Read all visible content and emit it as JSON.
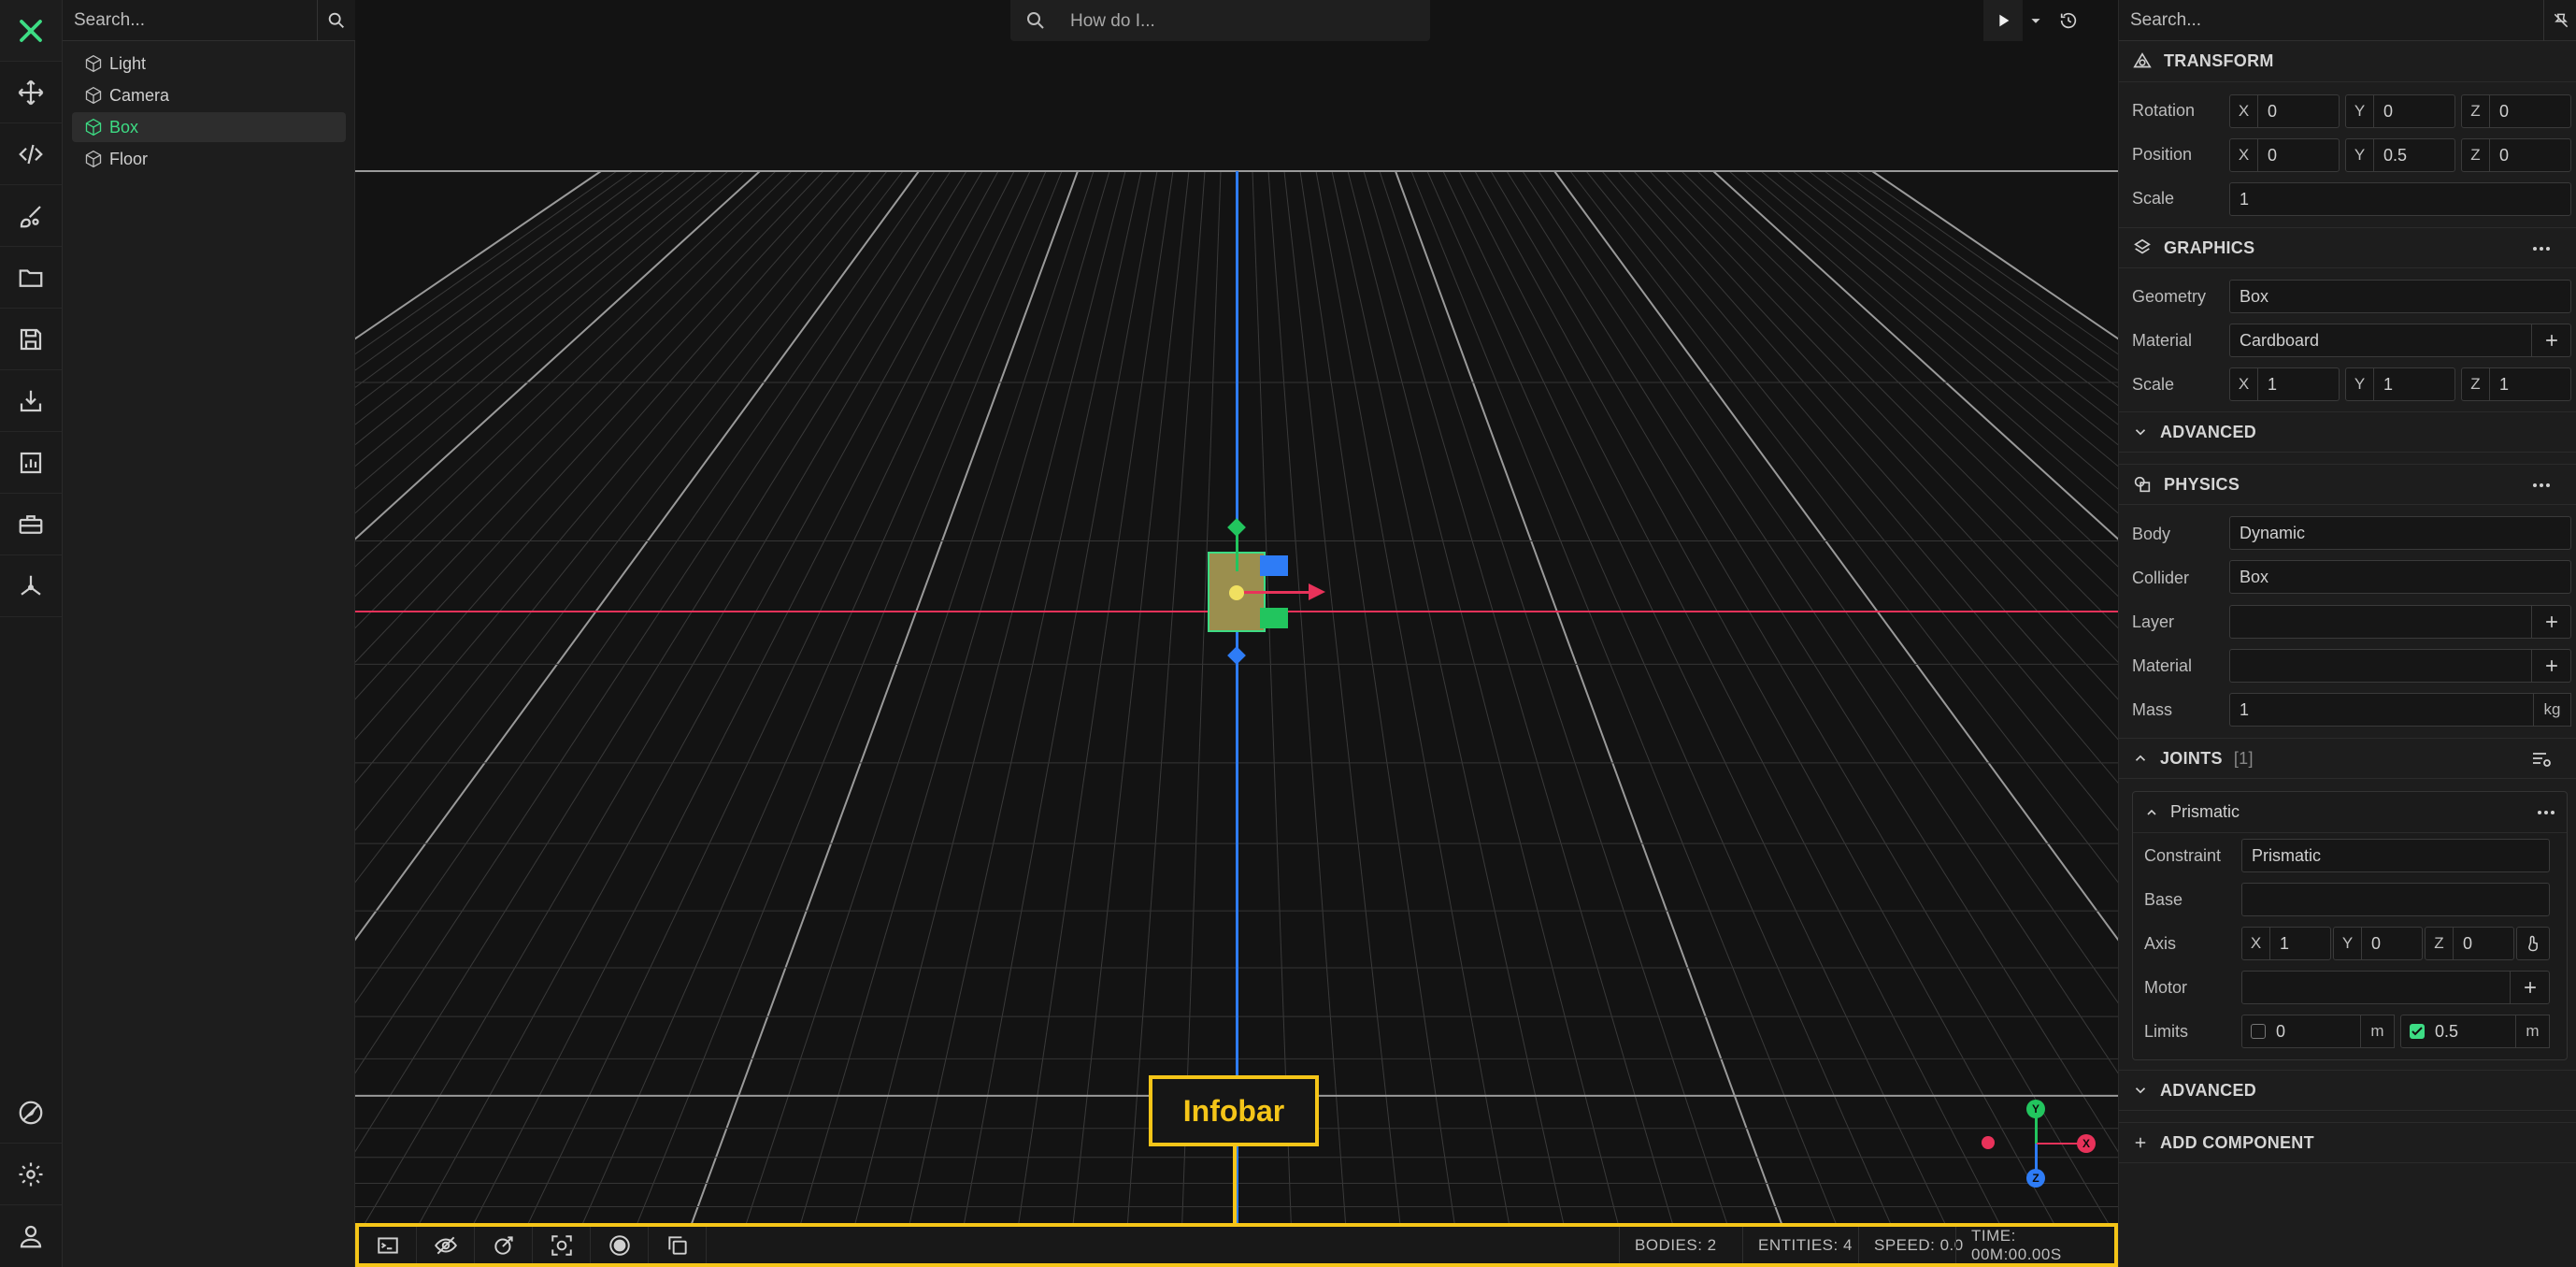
{
  "toolbar": {
    "tools": [
      "logo-icon",
      "move-icon",
      "code-icon",
      "brush-icon",
      "folder-icon",
      "save-icon",
      "import-icon",
      "chart-icon",
      "toolbox-icon",
      "axes-icon",
      "compass-off-icon",
      "gear-icon",
      "user-icon"
    ],
    "accent": "#3ddc84"
  },
  "scene_tree": {
    "search_placeholder": "Search...",
    "items": [
      {
        "label": "Light",
        "selected": false
      },
      {
        "label": "Camera",
        "selected": false
      },
      {
        "label": "Box",
        "selected": true
      },
      {
        "label": "Floor",
        "selected": false
      }
    ]
  },
  "viewport": {
    "help_search_placeholder": "How do I...",
    "callout_label": "Infobar",
    "gizmo_axes": {
      "x": "X",
      "y": "Y",
      "z": "Z"
    },
    "colors": {
      "x_axis": "#e8325a",
      "y_axis": "#22c55e",
      "z_axis": "#2e7cf6",
      "highlight": "#f5c518"
    }
  },
  "statusbar": {
    "buttons": [
      "terminal-icon",
      "eye-off-icon",
      "pen-target-icon",
      "focus-icon",
      "record-icon",
      "copy-icon"
    ],
    "bodies": "BODIES: 2",
    "entities": "ENTITIES: 4",
    "speed": "SPEED: 0.0",
    "time": "TIME: 00M:00.00S"
  },
  "inspector": {
    "search_placeholder": "Search...",
    "transform": {
      "title": "TRANSFORM",
      "rotation_label": "Rotation",
      "rotation": {
        "x": "0",
        "y": "0",
        "z": "0"
      },
      "position_label": "Position",
      "position": {
        "x": "0",
        "y": "0.5",
        "z": "0"
      },
      "scale_label": "Scale",
      "scale": "1"
    },
    "graphics": {
      "title": "GRAPHICS",
      "geometry_label": "Geometry",
      "geometry": "Box",
      "material_label": "Material",
      "material": "Cardboard",
      "scale_label": "Scale",
      "scale": {
        "x": "1",
        "y": "1",
        "z": "1"
      },
      "advanced": "ADVANCED"
    },
    "physics": {
      "title": "PHYSICS",
      "body_label": "Body",
      "body": "Dynamic",
      "collider_label": "Collider",
      "collider": "Box",
      "layer_label": "Layer",
      "layer": "",
      "material_label": "Material",
      "material": "",
      "mass_label": "Mass",
      "mass": "1",
      "mass_unit": "kg"
    },
    "joints": {
      "title": "JOINTS",
      "count": "[1]",
      "joint": {
        "title": "Prismatic",
        "constraint_label": "Constraint",
        "constraint": "Prismatic",
        "base_label": "Base",
        "base": "",
        "axis_label": "Axis",
        "axis": {
          "x": "1",
          "y": "0",
          "z": "0"
        },
        "motor_label": "Motor",
        "motor": "",
        "limits_label": "Limits",
        "limit_min": "0",
        "limit_min_checked": false,
        "limit_max": "0.5",
        "limit_max_checked": true,
        "unit": "m"
      },
      "advanced": "ADVANCED"
    },
    "add_component": "ADD COMPONENT"
  },
  "axis_letters": {
    "x": "X",
    "y": "Y",
    "z": "Z"
  }
}
